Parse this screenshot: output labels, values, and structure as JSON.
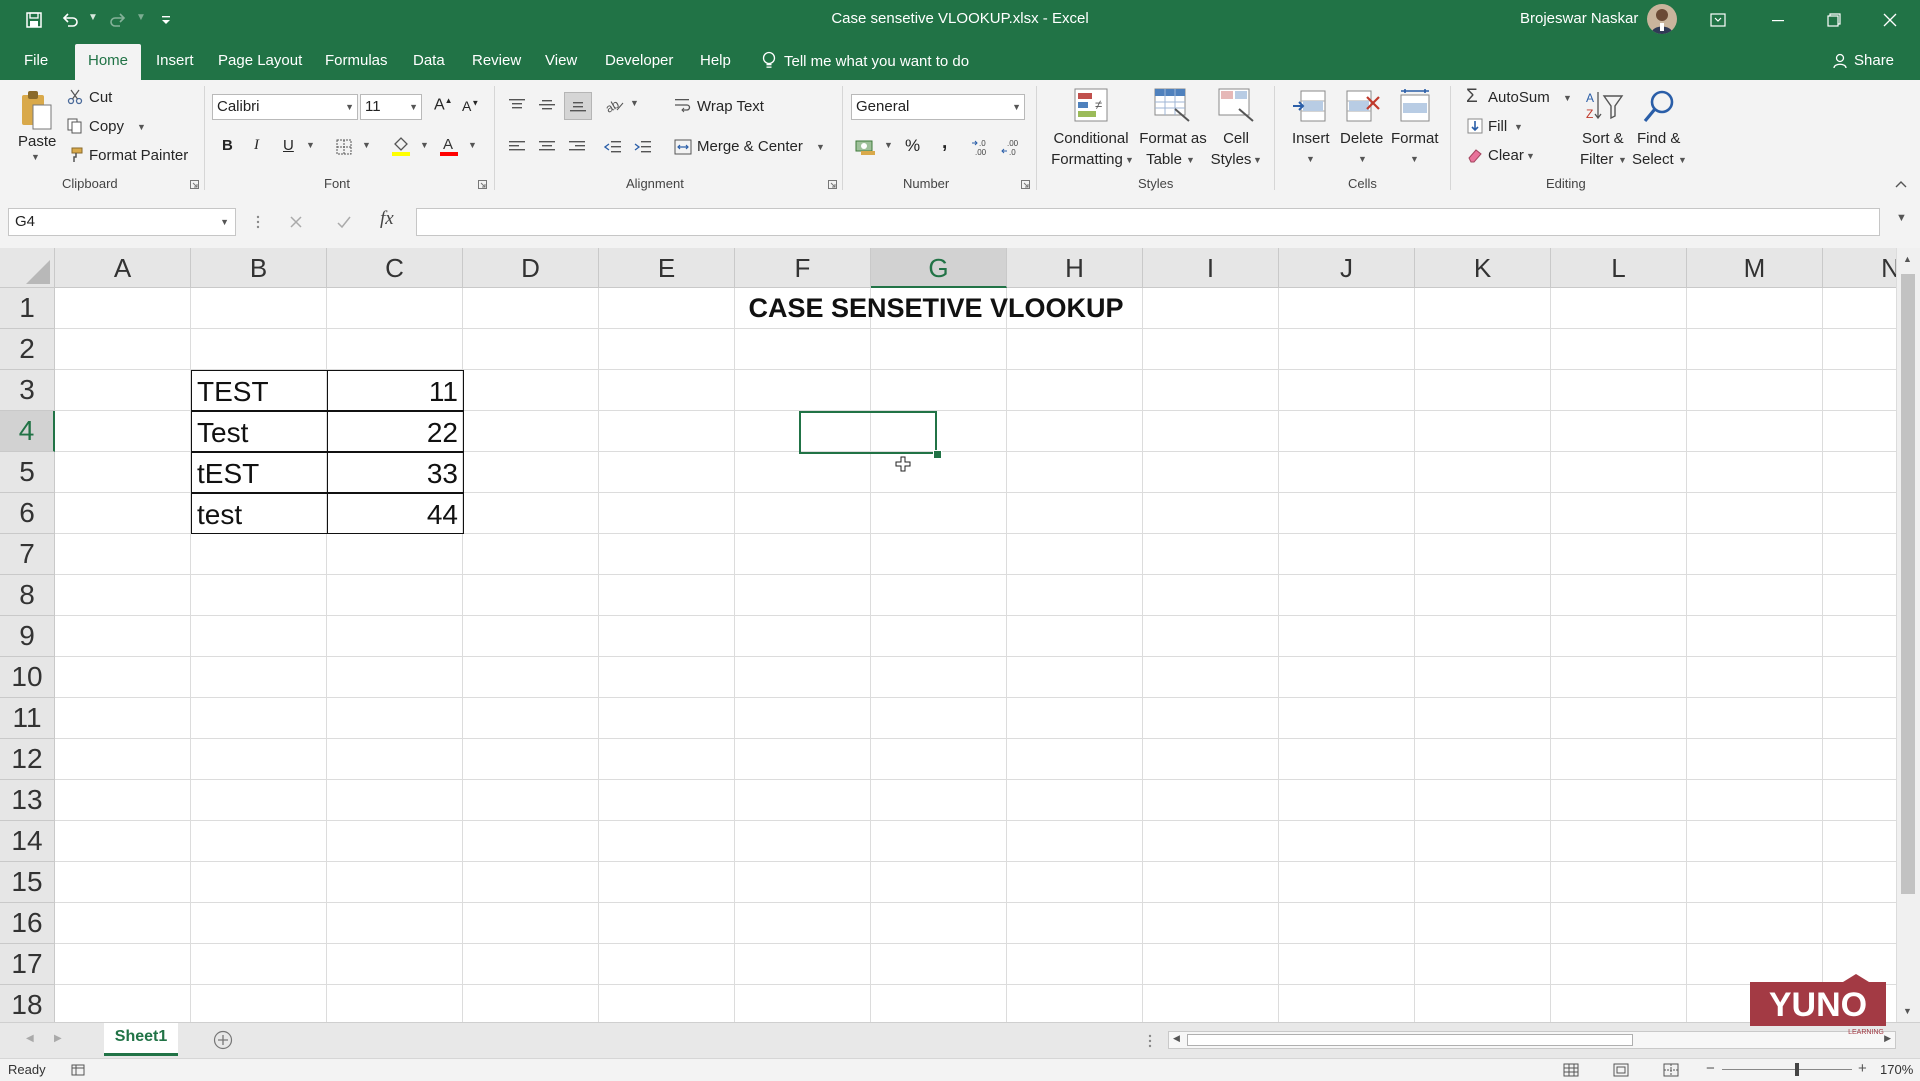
{
  "titlebar": {
    "document_title": "Case sensetive VLOOKUP.xlsx  -  Excel",
    "user_name": "Brojeswar Naskar"
  },
  "menu": {
    "tabs": [
      "File",
      "Home",
      "Insert",
      "Page Layout",
      "Formulas",
      "Data",
      "Review",
      "View",
      "Developer",
      "Help"
    ],
    "active_tab": "Home",
    "tell_me": "Tell me what you want to do",
    "share": "Share"
  },
  "ribbon": {
    "clipboard": {
      "paste": "Paste",
      "cut": "Cut",
      "copy": "Copy",
      "format_painter": "Format Painter",
      "label": "Clipboard"
    },
    "font": {
      "font_name": "Calibri",
      "font_size": "11",
      "bold": "B",
      "italic": "I",
      "underline": "U",
      "label": "Font",
      "highlight_color": "#FFFF00",
      "font_color": "#FF0000"
    },
    "alignment": {
      "wrap_text": "Wrap Text",
      "merge_center": "Merge & Center",
      "label": "Alignment"
    },
    "number": {
      "format": "General",
      "percent": "%",
      "comma": ",",
      "label": "Number"
    },
    "styles": {
      "conditional": [
        "Conditional",
        "Formatting"
      ],
      "format_table": [
        "Format as",
        "Table"
      ],
      "cell_styles": [
        "Cell",
        "Styles"
      ],
      "label": "Styles"
    },
    "cells": {
      "insert": "Insert",
      "delete": "Delete",
      "format": "Format",
      "label": "Cells"
    },
    "editing": {
      "autosum": "AutoSum",
      "fill": "Fill",
      "clear": "Clear",
      "sort_filter": [
        "Sort &",
        "Filter"
      ],
      "find_select": [
        "Find &",
        "Select"
      ],
      "label": "Editing"
    }
  },
  "formula_bar": {
    "name_box": "G4",
    "fx": "fx",
    "value": ""
  },
  "grid": {
    "columns": [
      "A",
      "B",
      "C",
      "D",
      "E",
      "F",
      "G",
      "H",
      "I",
      "J",
      "K",
      "L",
      "M",
      "N"
    ],
    "rows": [
      "1",
      "2",
      "3",
      "4",
      "5",
      "6",
      "7",
      "8",
      "9",
      "10",
      "11",
      "12",
      "13",
      "14",
      "15",
      "16",
      "17",
      "18"
    ],
    "selected_column": "G",
    "selected_row": "4",
    "title": "CASE SENSETIVE VLOOKUP",
    "table": [
      {
        "key": "TEST",
        "value": "11"
      },
      {
        "key": "Test",
        "value": "22"
      },
      {
        "key": "tEST",
        "value": "33"
      },
      {
        "key": "test",
        "value": "44"
      }
    ]
  },
  "sheets": {
    "tabs": [
      "Sheet1"
    ],
    "active": "Sheet1"
  },
  "status": {
    "ready": "Ready",
    "zoom": "170%"
  },
  "watermark": {
    "brand": "YUNO",
    "sub": "LEARNING"
  },
  "colors": {
    "accent": "#217346",
    "ribbon_bg": "#f3f3f3",
    "gridline": "#dcdcdc"
  }
}
